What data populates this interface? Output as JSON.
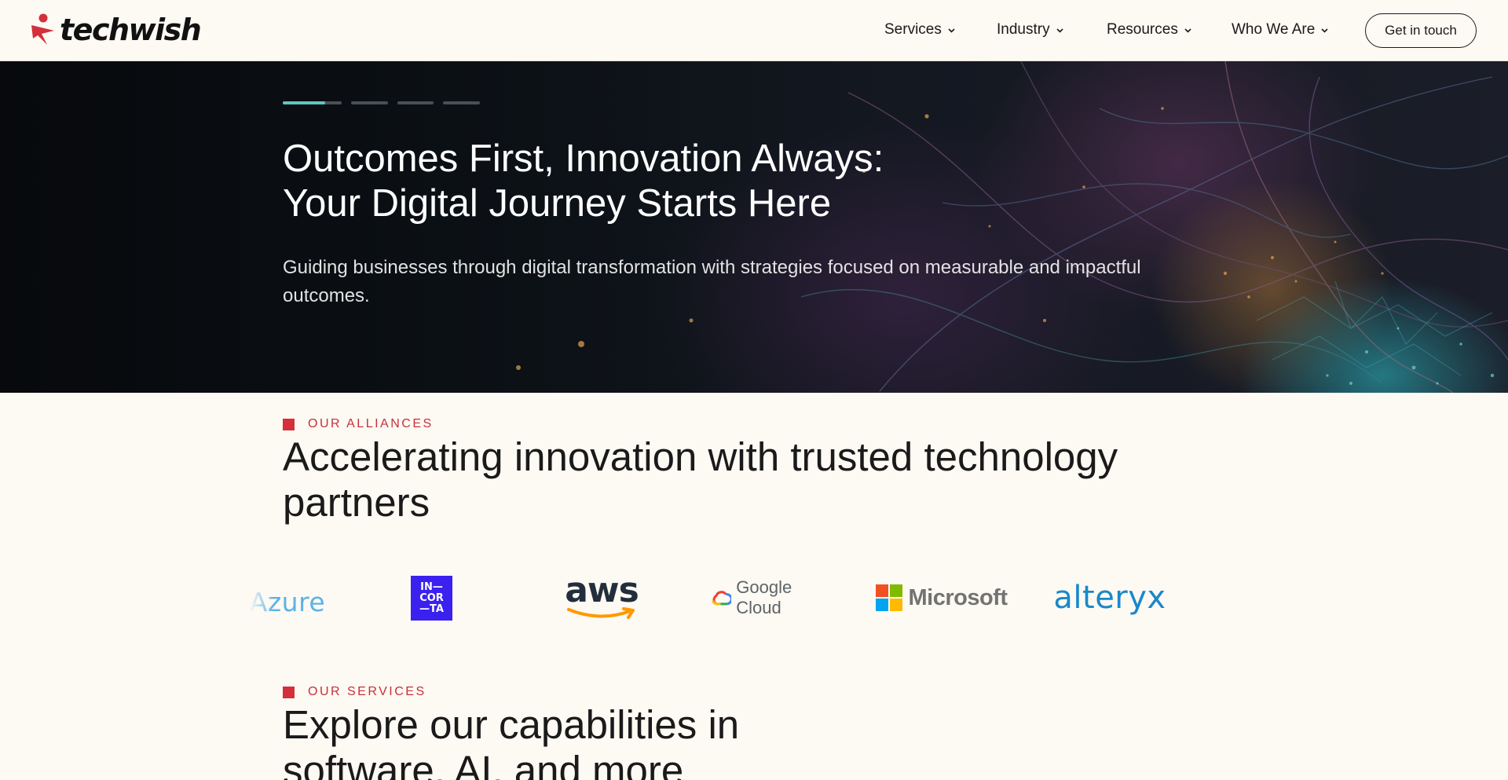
{
  "brand": {
    "name": "techwish",
    "accent_color": "#d3303b"
  },
  "nav": {
    "items": [
      {
        "label": "Services"
      },
      {
        "label": "Industry"
      },
      {
        "label": "Resources"
      },
      {
        "label": "Who We Are"
      }
    ],
    "cta_label": "Get in touch"
  },
  "hero": {
    "slide_count": 4,
    "active_slide": 1,
    "title_line1": "Outcomes First, Innovation Always:",
    "title_line2": "Your Digital Journey Starts Here",
    "subtitle": "Guiding businesses through digital transformation with strategies focused on measurable and impactful outcomes.",
    "indicator_color": "#5fc6bd"
  },
  "alliances": {
    "eyebrow": "OUR ALLIANCES",
    "title": "Accelerating innovation with trusted technology partners",
    "partners": [
      {
        "name": "Azure",
        "text": "Azure"
      },
      {
        "name": "Incorta",
        "lines": [
          "IN—",
          "COR",
          "—TA"
        ]
      },
      {
        "name": "AWS",
        "text": "aws"
      },
      {
        "name": "Google Cloud",
        "text": "Google Cloud"
      },
      {
        "name": "Microsoft",
        "text": "Microsoft"
      },
      {
        "name": "Alteryx",
        "text": "alteryx"
      }
    ]
  },
  "services": {
    "eyebrow": "OUR SERVICES",
    "title_line1": "Explore our capabilities in",
    "title_line2": "software, AI, and more"
  }
}
